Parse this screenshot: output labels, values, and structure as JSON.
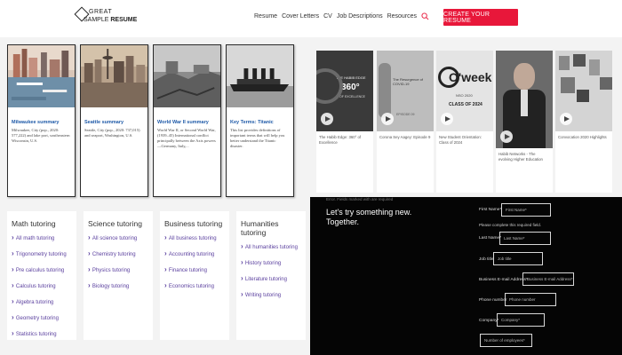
{
  "header": {
    "logo_line1": "GREAT",
    "logo_line2a": "SAMPLE",
    "logo_line2b": "RESUME",
    "nav": [
      "Resume",
      "Cover Letters",
      "CV",
      "Job Descriptions",
      "Resources"
    ],
    "cta": "CREATE YOUR RESUME"
  },
  "cards": [
    {
      "title": "Milwaukee summary",
      "desc": "Milwaukee, City (pop., 2020: 577,222) and lake port, southeastern Wisconsin, U.S."
    },
    {
      "title": "Seattle summary",
      "desc": "Seattle, City (pop., 2020: 737,015) and seaport, Washington, U.S."
    },
    {
      "title": "World War II summary",
      "desc": "World War II, or Second World War, (1939–45) International conflict principally between the Axis powers—Germany, Italy,..."
    },
    {
      "title": "Key Terms: Titanic",
      "desc": "This list provides definitions of important terms that will help you better understand the Titanic disaster."
    }
  ],
  "videos": [
    {
      "caption": "The Habib Edge: 360° of Excellence",
      "thumb_title": "THE HABIB EDGE",
      "thumb_big": "360°",
      "thumb_sub": "OF EXCELLENCE"
    },
    {
      "caption": "Corona Sey Aagey: Episode 9",
      "thumb_title": "The Resurgence of COVID-19",
      "thumb_big": "",
      "thumb_sub": "EPISODE 09"
    },
    {
      "caption": "New Student Orientation: Class of 2024",
      "thumb_title": "O'week",
      "thumb_big": "CLASS OF 2024",
      "thumb_sub": "NSO 2020"
    },
    {
      "caption": "Habib Networks - The evolving Higher Education",
      "thumb_title": "",
      "thumb_big": "",
      "thumb_sub": ""
    },
    {
      "caption": "Convocation 2020 Highlights",
      "thumb_title": "",
      "thumb_big": "",
      "thumb_sub": ""
    }
  ],
  "tutoring": [
    {
      "heading": "Math tutoring",
      "links": [
        "All math tutoring",
        "Trigonometry tutoring",
        "Pre calculus tutoring",
        "Calculus tutoring",
        "Algebra tutoring",
        "Geometry tutoring",
        "Statistics tutoring"
      ]
    },
    {
      "heading": "Science tutoring",
      "links": [
        "All science tutoring",
        "Chemistry tutoring",
        "Physics tutoring",
        "Biology tutoring"
      ]
    },
    {
      "heading": "Business tutoring",
      "links": [
        "All business tutoring",
        "Accounting tutoring",
        "Finance tutoring",
        "Economics tutoring"
      ]
    },
    {
      "heading": "Humanities tutoring",
      "links": [
        "All humanities tutoring",
        "History tutoring",
        "Literature tutoring",
        "Writing tutoring"
      ]
    }
  ],
  "form": {
    "top_text": "Error. Fields marked with are required",
    "intro1": "Let's try something new.",
    "intro2": "Together.",
    "first_name_label": "First Name*",
    "first_name_ph": "First Name*",
    "error": "Please complete this required field.",
    "last_name_label": "Last Name*",
    "last_name_ph": "Last Name*",
    "job_title_label": "Job title",
    "job_title_ph": "Job title",
    "email_label": "Business E-mail Address*",
    "email_ph": "Business E-mail Address*",
    "phone_label": "Phone number",
    "phone_ph": "Phone number",
    "company_label": "Company*",
    "company_ph": "Company*",
    "employees_ph": "Number of employees*"
  }
}
